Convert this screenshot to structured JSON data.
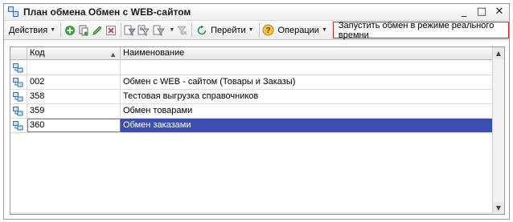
{
  "window": {
    "title": "План обмена Обмен с WEB-сайтом",
    "minimize_label": "_",
    "maximize_label": "□",
    "close_label": "✕"
  },
  "toolbar": {
    "actions_label": "Действия",
    "goto_label": "Перейти",
    "operations_label": "Операции",
    "realtime_exchange_label": "Запустить обмен в режиме реального времни",
    "help_label": "?"
  },
  "table": {
    "columns": [
      {
        "label": ""
      },
      {
        "label": "Код"
      },
      {
        "label": "Наименование"
      }
    ],
    "rows": [
      {
        "code": "",
        "name": "",
        "selected": false
      },
      {
        "code": "002",
        "name": "Обмен с WEB - сайтом (Товары и Заказы)",
        "selected": false
      },
      {
        "code": "358",
        "name": "Тестовая выгрузка справочников",
        "selected": false
      },
      {
        "code": "359",
        "name": "Обмен товарами",
        "selected": false
      },
      {
        "code": "360",
        "name": "Обмен заказами",
        "selected": true
      }
    ]
  },
  "colors": {
    "selection": "#3d4eb3",
    "highlight_border": "#c62828",
    "add_icon": "#3aa13a",
    "delete_icon": "#d32f2f"
  }
}
